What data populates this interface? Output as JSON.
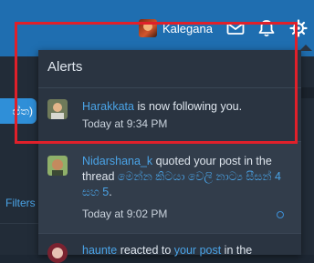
{
  "header": {
    "username": "Kalegana",
    "icons": [
      "mail-icon",
      "bell-icon",
      "gear-icon"
    ]
  },
  "left": {
    "pill_text": "ස්ත)",
    "filters_label": "Filters"
  },
  "alerts": {
    "title": "Alerts",
    "items": [
      {
        "user": "Harakkata",
        "text": " is now following you.",
        "time": "Today at 9:34 PM"
      },
      {
        "user": "Nidarshana_k",
        "text": " quoted your post in the thread ",
        "thread": "මෙන්න කිටයා වෙලි නාට්‍ය සීසන් 4 සහ 5",
        "suffix": ".",
        "time": "Today at 9:02 PM"
      },
      {
        "user": "haunte",
        "text": " reacted to ",
        "link": "your post",
        "suffix": " in the"
      }
    ]
  },
  "colors": {
    "header_blue": "#1f6eb0",
    "link_blue": "#4aa3e6",
    "highlight_red": "#e0202a",
    "panel_bg": "#2a3441"
  }
}
